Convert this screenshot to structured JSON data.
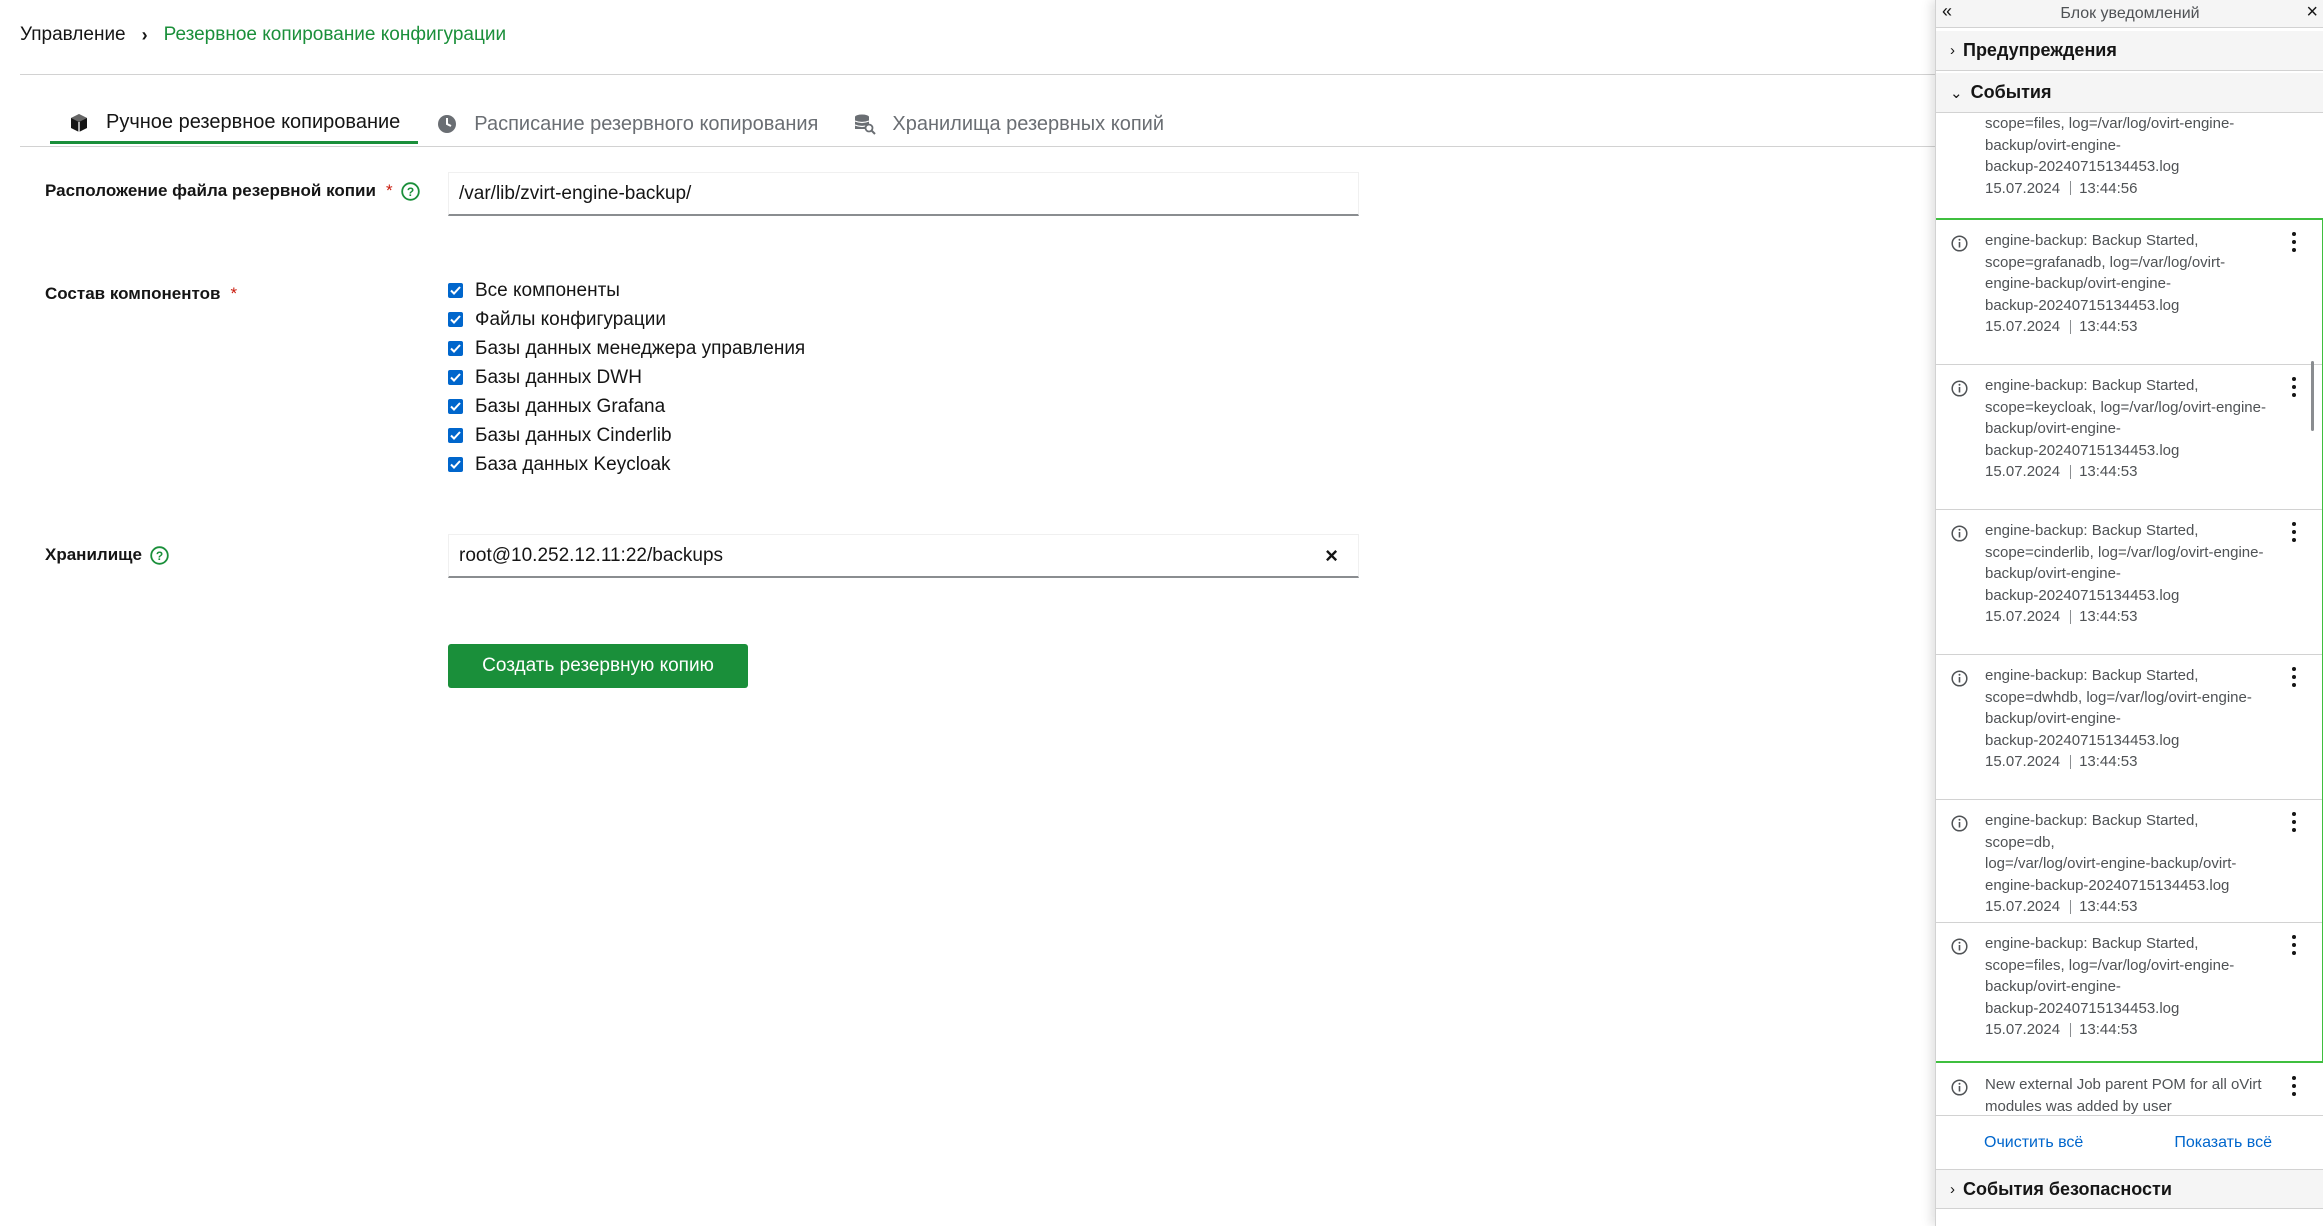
{
  "breadcrumb": {
    "root": "Управление",
    "current": "Резервное копирование конфигурации"
  },
  "tabs": [
    {
      "label": "Ручное резервное копирование",
      "icon": "cube-icon",
      "active": true
    },
    {
      "label": "Расписание резервного копирования",
      "icon": "clock-icon",
      "active": false
    },
    {
      "label": "Хранилища резервных копий",
      "icon": "storage-search-icon",
      "active": false
    }
  ],
  "form": {
    "location_label": "Расположение файла резервной копии",
    "location_value": "/var/lib/zvirt-engine-backup/",
    "components_label": "Состав компонентов",
    "required_mark": "*",
    "components": [
      {
        "label": "Все компоненты",
        "checked": true
      },
      {
        "label": "Файлы конфигурации",
        "checked": true
      },
      {
        "label": "Базы данных менеджера управления",
        "checked": true
      },
      {
        "label": "Базы данных DWH",
        "checked": true
      },
      {
        "label": "Базы данных Grafana",
        "checked": true
      },
      {
        "label": "Базы данных Cinderlib",
        "checked": true
      },
      {
        "label": "База данных Keycloak",
        "checked": true
      }
    ],
    "storage_label": "Хранилище",
    "storage_value": "root@10.252.12.11:22/backups",
    "clear_symbol": "×",
    "submit_label": "Создать резервную копию"
  },
  "drawer": {
    "title": "Блок уведомлений",
    "collapse_symbol": "«",
    "close_symbol": "×",
    "groups": {
      "warnings": "Предупреждения",
      "events": "События",
      "security": "События безопасности"
    },
    "partial_event": {
      "lines": [
        "scope=files, log=/var/log/ovirt-engine-",
        "backup/ovirt-engine-",
        "backup-20240715134453.log"
      ],
      "date": "15.07.2024",
      "time": "13:44:56"
    },
    "events": [
      {
        "lines": [
          "engine-backup: Backup Started,",
          "scope=grafanadb, log=/var/log/ovirt-",
          "engine-backup/ovirt-engine-",
          "backup-20240715134453.log"
        ],
        "date": "15.07.2024",
        "time": "13:44:53"
      },
      {
        "lines": [
          "engine-backup: Backup Started,",
          "scope=keycloak, log=/var/log/ovirt-engine-",
          "backup/ovirt-engine-",
          "backup-20240715134453.log"
        ],
        "date": "15.07.2024",
        "time": "13:44:53"
      },
      {
        "lines": [
          "engine-backup: Backup Started,",
          "scope=cinderlib, log=/var/log/ovirt-engine-",
          "backup/ovirt-engine-",
          "backup-20240715134453.log"
        ],
        "date": "15.07.2024",
        "time": "13:44:53"
      },
      {
        "lines": [
          "engine-backup: Backup Started,",
          "scope=dwhdb, log=/var/log/ovirt-engine-",
          "backup/ovirt-engine-",
          "backup-20240715134453.log"
        ],
        "date": "15.07.2024",
        "time": "13:44:53"
      },
      {
        "lines": [
          "engine-backup: Backup Started, scope=db,",
          "log=/var/log/ovirt-engine-backup/ovirt-",
          "engine-backup-20240715134453.log"
        ],
        "date": "15.07.2024",
        "time": "13:44:53"
      },
      {
        "lines": [
          "engine-backup: Backup Started,",
          "scope=files, log=/var/log/ovirt-engine-",
          "backup/ovirt-engine-",
          "backup-20240715134453.log"
        ],
        "date": "15.07.2024",
        "time": "13:44:53"
      }
    ],
    "last_event": {
      "lines": [
        "New external Job parent POM for all oVirt",
        "modules was added by user"
      ]
    },
    "clear_all": "Очистить всё",
    "show_all": "Показать всё"
  },
  "colors": {
    "accent": "#1a8f3a",
    "link": "#0066cc",
    "checkbox": "#0066cc",
    "highlight": "#3fbf3f"
  }
}
